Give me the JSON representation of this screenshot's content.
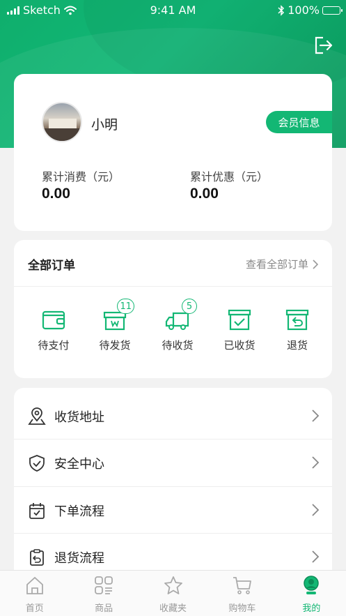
{
  "status_bar": {
    "carrier": "Sketch",
    "time": "9:41 AM",
    "battery": "100%"
  },
  "profile": {
    "name": "小明",
    "member_button": "会员信息",
    "stats": [
      {
        "label": "累计消费（元）",
        "value": "0.00"
      },
      {
        "label": "累计优惠（元）",
        "value": "0.00"
      }
    ]
  },
  "orders": {
    "title": "全部订单",
    "view_all": "查看全部订单",
    "items": [
      {
        "label": "待支付",
        "icon": "wallet-icon",
        "badge": ""
      },
      {
        "label": "待发货",
        "icon": "package-icon",
        "badge": "11"
      },
      {
        "label": "待收货",
        "icon": "truck-icon",
        "badge": "5"
      },
      {
        "label": "已收货",
        "icon": "box-check-icon",
        "badge": ""
      },
      {
        "label": "退货",
        "icon": "return-box-icon",
        "badge": ""
      }
    ]
  },
  "menu": [
    {
      "label": "收货地址",
      "icon": "location-pin-icon"
    },
    {
      "label": "安全中心",
      "icon": "shield-check-icon"
    },
    {
      "label": "下单流程",
      "icon": "calendar-check-icon"
    },
    {
      "label": "退货流程",
      "icon": "clipboard-return-icon"
    }
  ],
  "tabbar": [
    {
      "label": "首页",
      "icon": "home-icon",
      "active": false
    },
    {
      "label": "商品",
      "icon": "grid-icon",
      "active": false
    },
    {
      "label": "收藏夹",
      "icon": "star-icon",
      "active": false
    },
    {
      "label": "购物车",
      "icon": "cart-icon",
      "active": false
    },
    {
      "label": "我的",
      "icon": "profile-icon",
      "active": true
    }
  ],
  "colors": {
    "accent": "#13b774",
    "header_gradient_start": "#0fae6c",
    "background": "#f2f2f2"
  }
}
